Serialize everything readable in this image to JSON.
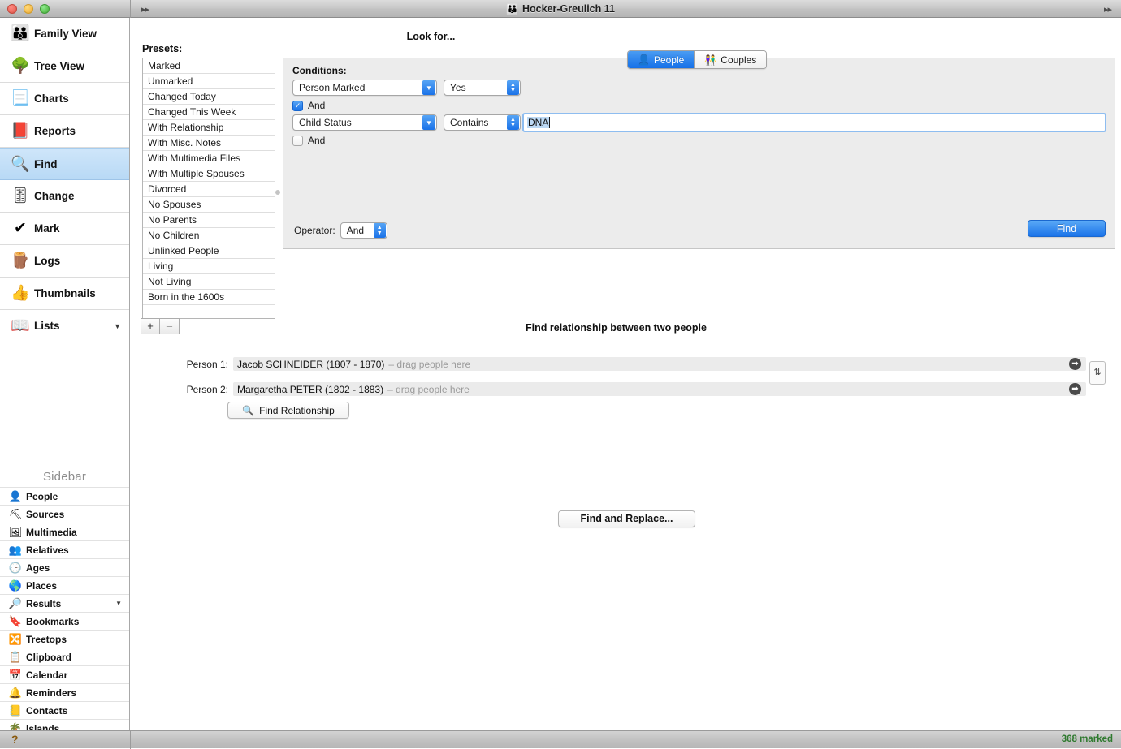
{
  "window": {
    "title": "Hocker-Greulich 11",
    "title_icon": "family-icon",
    "left_arrows": "▸▸",
    "right_arrows": "▸▸"
  },
  "sidebar": {
    "nav_items": [
      {
        "label": "Family View",
        "icon": "👪",
        "selected": false
      },
      {
        "label": "Tree View",
        "icon": "🌳",
        "selected": false
      },
      {
        "label": "Charts",
        "icon": "📃",
        "selected": false
      },
      {
        "label": "Reports",
        "icon": "📕",
        "selected": false
      },
      {
        "label": "Find",
        "icon": "🔍",
        "selected": true
      },
      {
        "label": "Change",
        "icon": "🎚",
        "selected": false
      },
      {
        "label": "Mark",
        "icon": "✔",
        "selected": false
      },
      {
        "label": "Logs",
        "icon": "🪵",
        "selected": false
      },
      {
        "label": "Thumbnails",
        "icon": "👍",
        "selected": false
      },
      {
        "label": "Lists",
        "icon": "📖",
        "selected": false,
        "caret": "▼"
      }
    ],
    "section_title": "Sidebar",
    "items": [
      {
        "label": "People",
        "icon": "👤"
      },
      {
        "label": "Sources",
        "icon": "⛏"
      },
      {
        "label": "Multimedia",
        "icon": "🖼"
      },
      {
        "label": "Relatives",
        "icon": "👥"
      },
      {
        "label": "Ages",
        "icon": "🕒"
      },
      {
        "label": "Places",
        "icon": "🌎"
      },
      {
        "label": "Results",
        "icon": "🔎",
        "caret": "▼"
      },
      {
        "label": "Bookmarks",
        "icon": "🔖"
      },
      {
        "label": "Treetops",
        "icon": "🔀"
      },
      {
        "label": "Clipboard",
        "icon": "📋"
      },
      {
        "label": "Calendar",
        "icon": "📅"
      },
      {
        "label": "Reminders",
        "icon": "🔔"
      },
      {
        "label": "Contacts",
        "icon": "📒"
      },
      {
        "label": "Islands",
        "icon": "🌴"
      }
    ]
  },
  "presets": {
    "label": "Presets:",
    "items": [
      "Marked",
      "Unmarked",
      "Changed Today",
      "Changed This Week",
      "With Relationship",
      "With Misc. Notes",
      "With Multimedia Files",
      "With Multiple Spouses",
      "Divorced",
      "No Spouses",
      "No Parents",
      "No Children",
      "Unlinked People",
      "Living",
      "Not Living",
      "Born in the 1600s"
    ],
    "add_label": "+",
    "remove_label": "–"
  },
  "look_for": {
    "title": "Look for...",
    "options": [
      {
        "label": "People",
        "icon": "👤",
        "active": true
      },
      {
        "label": "Couples",
        "icon": "👫",
        "active": false
      }
    ]
  },
  "conditions": {
    "label": "Conditions:",
    "row1": {
      "field": "Person Marked",
      "operator": "Yes"
    },
    "and1": {
      "label": "And",
      "checked": true
    },
    "row2": {
      "field": "Child Status",
      "operator": "Contains",
      "value": "DNA"
    },
    "and2": {
      "label": "And",
      "checked": false
    },
    "operator_label": "Operator:",
    "operator_value": "And",
    "find_label": "Find"
  },
  "relationship": {
    "title": "Find relationship between two people",
    "person1_label": "Person 1:",
    "person1_name": "Jacob SCHNEIDER (1807 - 1870)",
    "person1_hint": "– drag people here",
    "person2_label": "Person 2:",
    "person2_name": "Margaretha PETER (1802 - 1883)",
    "person2_hint": "– drag people here",
    "find_rel_label": "Find Relationship",
    "find_rel_icon": "🔍",
    "swap_icon": "⇅",
    "go_icon": "➡"
  },
  "footer": {
    "find_replace_label": "Find and Replace...",
    "help_label": "?",
    "status": "368 marked",
    "status_color": "#2f7a2f"
  }
}
